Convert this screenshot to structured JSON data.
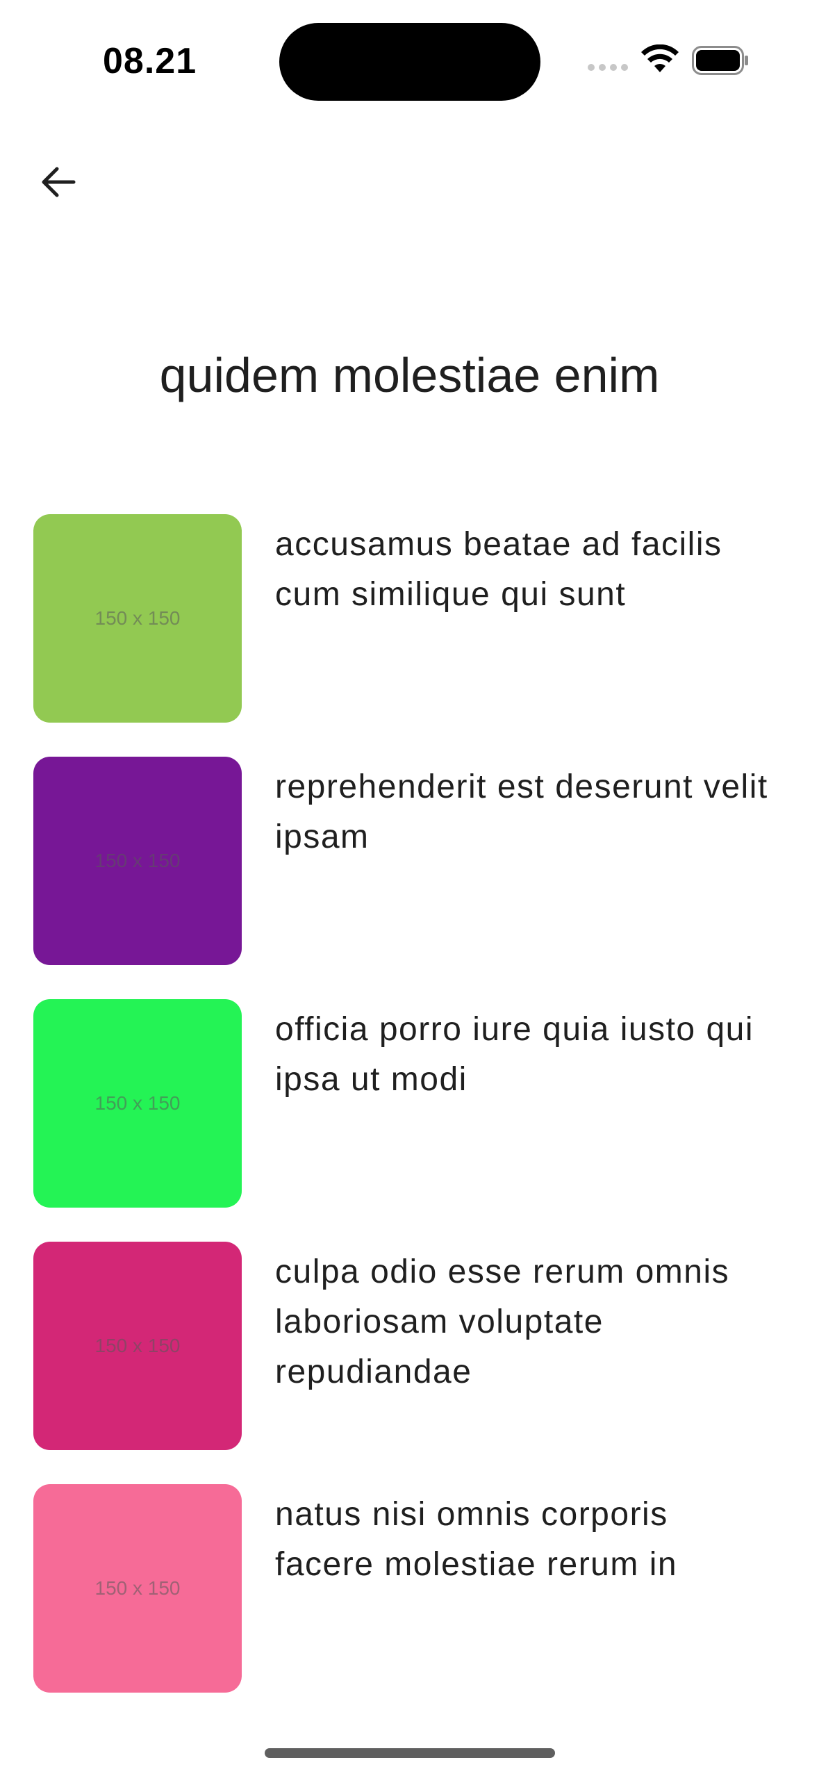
{
  "status_bar": {
    "time": "08.21"
  },
  "nav": {
    "back_icon": "arrow-left-icon"
  },
  "page": {
    "title": "quidem molestiae enim"
  },
  "items": [
    {
      "thumb_label": "150 x 150",
      "thumb_color": "#92c952",
      "text": "accusamus beatae ad facilis cum similique qui sunt"
    },
    {
      "thumb_label": "150 x 150",
      "thumb_color": "#771796",
      "text": "reprehenderit est deserunt velit ipsam"
    },
    {
      "thumb_label": "150 x 150",
      "thumb_color": "#24f355",
      "text": "officia porro iure quia iusto qui ipsa ut modi"
    },
    {
      "thumb_label": "150 x 150",
      "thumb_color": "#d32776",
      "text": "culpa odio esse rerum omnis laboriosam voluptate repudiandae"
    },
    {
      "thumb_label": "150 x 150",
      "thumb_color": "#f66b97",
      "text": "natus nisi omnis corporis facere molestiae rerum in"
    }
  ]
}
